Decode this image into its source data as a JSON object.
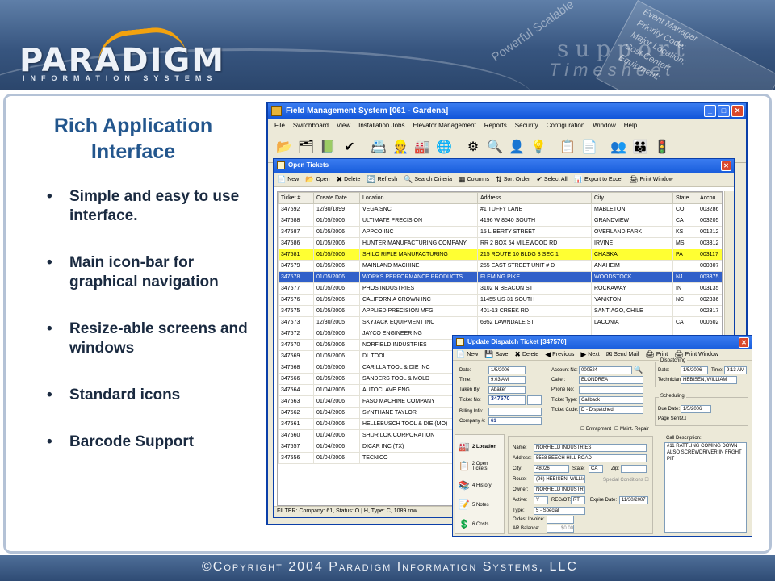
{
  "header": {
    "logo_word": "PARADIGM",
    "logo_sub": "INFORMATION SYSTEMS",
    "tagline_powerful": "Powerful Scalable",
    "tagline_support": "support",
    "tagline_timesheet": "Timesheet",
    "badge_lines": [
      "Event Manager",
      "Priority Code:",
      "Major Location:",
      "Cost Center:",
      "Equipment:"
    ]
  },
  "slide": {
    "title": "Rich Application Interface",
    "bullets": [
      "Simple and easy to use interface.",
      "Main icon-bar for graphical navigation",
      "Resize-able screens and windows",
      "Standard icons",
      "Barcode Support"
    ]
  },
  "footer": {
    "copyright": "©Copyright 2004 Paradigm Information Systems, LLC"
  },
  "app": {
    "title": "Field Management System [061 - Gardena]",
    "menu": [
      "File",
      "Switchboard",
      "View",
      "Installation Jobs",
      "Elevator Management",
      "Reports",
      "Security",
      "Configuration",
      "Window",
      "Help"
    ],
    "icons": [
      "📂",
      "🗂",
      "📗",
      "✔",
      "📇",
      "👷",
      "🏭",
      "🌐",
      "⚙",
      "🔍",
      "👤",
      "💡",
      "📋",
      "📄",
      "👥",
      "👪",
      "🚦"
    ]
  },
  "open_tickets": {
    "title": "Open Tickets",
    "toolbar": [
      {
        "icon": "📄",
        "label": "New"
      },
      {
        "icon": "📂",
        "label": "Open"
      },
      {
        "icon": "✖",
        "label": "Delete"
      },
      {
        "icon": "🔄",
        "label": "Refresh"
      },
      {
        "icon": "🔍",
        "label": "Search Criteria"
      },
      {
        "icon": "▦",
        "label": "Columns"
      },
      {
        "icon": "⇅",
        "label": "Sort Order"
      },
      {
        "icon": "✔",
        "label": "Select All"
      },
      {
        "icon": "📊",
        "label": "Export to Excel"
      },
      {
        "icon": "🖨",
        "label": "Print Window"
      }
    ],
    "columns": [
      "Ticket #",
      "Create Date",
      "Location",
      "Address",
      "City",
      "State",
      "Accou"
    ],
    "rows": [
      [
        "347592",
        "12/30/1899",
        "VEGA SNC",
        "#1 TUFFY LANE",
        "MABLETON",
        "CO",
        "003286"
      ],
      [
        "347588",
        "01/05/2006",
        "ULTIMATE PRECISION",
        "4196 W 8540 SOUTH",
        "GRANDVIEW",
        "CA",
        "003205"
      ],
      [
        "347587",
        "01/05/2006",
        "APPCO INC",
        "15 LIBERTY STREET",
        "OVERLAND PARK",
        "KS",
        "001212"
      ],
      [
        "347586",
        "01/05/2006",
        "HUNTER MANUFACTURING COMPANY",
        "RR 2 BOX 54 MILEWOOD RD",
        "IRVINE",
        "MS",
        "003312"
      ],
      [
        "347581",
        "01/05/2006",
        "SHILO RIFLE MANUFACTURING",
        "215 ROUTE 10 BLDG 3 SEC 1",
        "CHASKA",
        "PA",
        "003117"
      ],
      [
        "347579",
        "01/05/2006",
        "MAINLAND MACHINE",
        "255 EAST STREET UNIT # D",
        "ANAHEIM",
        "",
        "000307"
      ],
      [
        "347578",
        "01/05/2006",
        "WORKS PERFORMANCE PRODUCTS",
        "FLEMING PIKE",
        "WOODSTOCK",
        "NJ",
        "003375"
      ],
      [
        "347577",
        "01/05/2006",
        "PHOS INDUSTRIES",
        "3102 N BEACON ST",
        "ROCKAWAY",
        "IN",
        "003135"
      ],
      [
        "347576",
        "01/05/2006",
        "CALIFORNIA CROWN INC",
        "11455 US-31 SOUTH",
        "YANKTON",
        "NC",
        "002336"
      ],
      [
        "347575",
        "01/05/2006",
        "APPLIED PRECISION MFG",
        "401-13 CREEK RD",
        "SANTIAGO, CHILE",
        "",
        "002317"
      ],
      [
        "347573",
        "12/30/2005",
        "SKYJACK EQUIPMENT INC",
        "6952 LAWNDALE ST",
        "LACONIA",
        "CA",
        "000602"
      ],
      [
        "347572",
        "01/05/2006",
        "JAYCO ENGINEERING",
        "",
        "",
        "",
        ""
      ],
      [
        "347570",
        "01/05/2006",
        "NORFIELD INDUSTRIES",
        "",
        "",
        "",
        ""
      ],
      [
        "347569",
        "01/05/2006",
        "DL TOOL",
        "",
        "",
        "",
        ""
      ],
      [
        "347568",
        "01/05/2006",
        "CARILLA TOOL & DIE INC",
        "",
        "",
        "",
        ""
      ],
      [
        "347566",
        "01/05/2006",
        "SANDERS TOOL & MOLD",
        "",
        "",
        "",
        ""
      ],
      [
        "347564",
        "01/04/2006",
        "AUTOCLAVE ENG",
        "",
        "",
        "",
        ""
      ],
      [
        "347563",
        "01/04/2006",
        "FASO MACHINE COMPANY",
        "",
        "",
        "",
        ""
      ],
      [
        "347562",
        "01/04/2006",
        "SYNTHANE TAYLOR",
        "",
        "",
        "",
        ""
      ],
      [
        "347561",
        "01/04/2006",
        "HELLEBUSCH TOOL & DIE (MO)",
        "",
        "",
        "",
        ""
      ],
      [
        "347560",
        "01/04/2006",
        "SHUR LOK CORPORATION",
        "",
        "",
        "",
        ""
      ],
      [
        "347557",
        "01/04/2006",
        "DICAR INC (TX)",
        "",
        "",
        "",
        ""
      ],
      [
        "347556",
        "01/04/2006",
        "TECNICO",
        "",
        "",
        "",
        ""
      ]
    ],
    "highlight_yellow_row": 4,
    "highlight_blue_row": 6,
    "status": "FILTER: Company: 61, Status: O | H, Type: C, 1089 row"
  },
  "dispatch": {
    "title": "Update Dispatch Ticket [347570]",
    "toolbar": [
      {
        "icon": "📄",
        "label": "New"
      },
      {
        "icon": "💾",
        "label": "Save"
      },
      {
        "icon": "✖",
        "label": "Delete"
      },
      {
        "icon": "◀",
        "label": "Previous"
      },
      {
        "icon": "▶",
        "label": "Next"
      },
      {
        "icon": "✉",
        "label": "Send Mail"
      },
      {
        "icon": "🖨",
        "label": "Print"
      },
      {
        "icon": "🖨",
        "label": "Print Window"
      }
    ],
    "left": {
      "date_label": "Date:",
      "date": "1/5/2006",
      "time_label": "Time:",
      "time": "9:03 AM",
      "taken_label": "Taken By:",
      "taken": "Abaker",
      "ticket_label": "Ticket No:",
      "ticket": "347570",
      "billing_label": "Billing Info:",
      "company_label": "Company #:",
      "company": "61"
    },
    "middle": {
      "account_label": "Account No:",
      "account": "000524",
      "caller_label": "Caller:",
      "caller": "ELONDREA",
      "phone_label": "Phone No:",
      "type_label": "Ticket Type:",
      "type": "Callback",
      "code_label": "Ticket Code:",
      "code": "D - Dispatched",
      "entrapment": "Entrapment",
      "maint_repair": "Maint. Repair"
    },
    "right": {
      "dispatching": "Dispatching",
      "date_label": "Date:",
      "date": "1/5/2006",
      "time_label": "Time:",
      "time": "9:13 AM",
      "tech_label": "Technician:",
      "tech": "HEBISEN, WILLIAM",
      "scheduling": "Scheduling",
      "due_label": "Due Date:",
      "due": "1/5/2006",
      "page_label": "Page Sent?"
    },
    "side": [
      {
        "icon": "🏭",
        "label": "2 Location"
      },
      {
        "icon": "📋",
        "label": "2 Open Tickets"
      },
      {
        "icon": "📚",
        "label": "4 History"
      },
      {
        "icon": "📝",
        "label": "5 Notes"
      },
      {
        "icon": "💲",
        "label": "6 Costs"
      }
    ],
    "location": {
      "name_label": "Name:",
      "name": "NORFIELD INDUSTRIES",
      "address_label": "Address:",
      "address": "5558 BEECH HILL ROAD",
      "city_label": "City:",
      "city": "48026",
      "state_label": "State:",
      "state": "CA",
      "zip_label": "Zip:",
      "route_label": "Route:",
      "route": "(26) HEBISEN, WILLIAM",
      "special": "Special Conditions",
      "owner_label": "Owner:",
      "owner": "NORFIELD INDUSTRIES",
      "active_label": "Active:",
      "active": "Y",
      "reg_label": "REG/OT:",
      "reg": "RT",
      "expire_label": "Expire Date:",
      "expire": "11/30/2007",
      "ptype_label": "Type:",
      "ptype": "5 - Special",
      "oldest_label": "Oldest Invoice:",
      "ar_label": "AR Balance:",
      "ar": "$0.00"
    },
    "call_description_label": "Call Description:",
    "call_description": "#11 RATTLING COMING DOWN ALSO SCREWDRIVER IN FRGHT PIT"
  }
}
